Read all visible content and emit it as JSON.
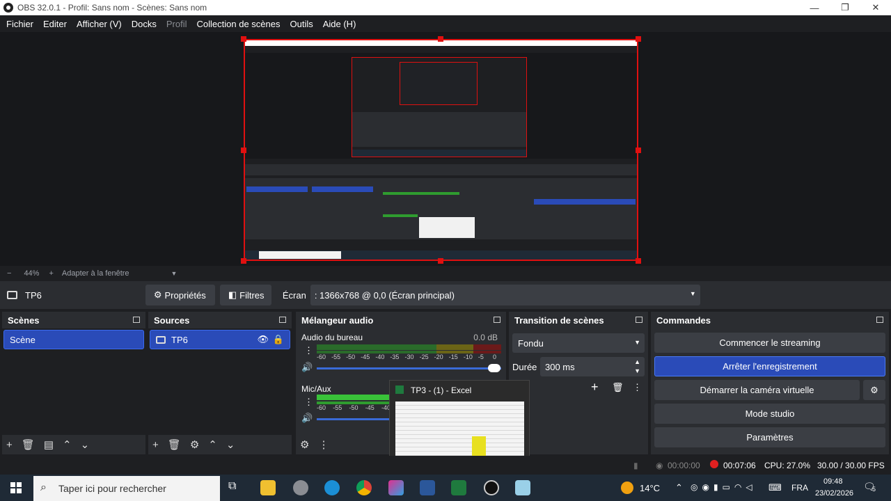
{
  "window": {
    "title": "OBS 32.0.1 - Profil: Sans nom - Scènes: Sans nom",
    "minimize": "—",
    "maximize": "❐",
    "close": "✕"
  },
  "menu": [
    "Fichier",
    "Editer",
    "Afficher (V)",
    "Docks",
    "Profil",
    "Collection de scènes",
    "Outils",
    "Aide (H)"
  ],
  "zoom": {
    "minus": "−",
    "value": "44%",
    "plus": "+",
    "fit": "Adapter à la fenêtre"
  },
  "source_bar": {
    "source_name": "TP6",
    "properties": "Propriétés",
    "filters": "Filtres",
    "screen_label": "Écran",
    "screen_value": ": 1366x768 @ 0,0 (Écran principal)"
  },
  "scenes": {
    "title": "Scènes",
    "items": [
      "Scène"
    ]
  },
  "sources": {
    "title": "Sources",
    "items": [
      "TP6"
    ]
  },
  "mixer": {
    "title": "Mélangeur audio",
    "channels": [
      {
        "name": "Audio du bureau",
        "db": "0.0 dB",
        "level": 0.0
      },
      {
        "name": "Mic/Aux",
        "db": "",
        "level": 0.6
      }
    ],
    "ticks": [
      "-60",
      "-55",
      "-50",
      "-45",
      "-40",
      "-35",
      "-30",
      "-25",
      "-20",
      "-15",
      "-10",
      "-5",
      "0"
    ],
    "ticks_short": [
      "-60",
      "-55",
      "-50",
      "-45",
      "-40"
    ]
  },
  "transition": {
    "title": "Transition de scènes",
    "type": "Fondu",
    "duration_label": "Durée",
    "duration_value": "300 ms"
  },
  "commands": {
    "title": "Commandes",
    "buttons": [
      "Commencer le streaming",
      "Arrêter l'enregistrement",
      "Démarrer la caméra virtuelle",
      "Mode studio",
      "Paramètres"
    ]
  },
  "excel_popup": {
    "title": "TP3 -  (1) - Excel"
  },
  "status": {
    "stream_time": "00:00:00",
    "rec_time": "00:07:06",
    "cpu": "CPU: 27.0%",
    "fps": "30.00 / 30.00 FPS"
  },
  "taskbar": {
    "search_placeholder": "Taper ici pour rechercher",
    "weather": "14°C",
    "lang": "FRA",
    "time": "09:48",
    "date": "23/02/2026",
    "notif_count": "5"
  },
  "colors": {
    "accent": "#2a4bb8",
    "bg": "#1e1f22",
    "panel": "#2b2d31",
    "record": "#e02020"
  }
}
